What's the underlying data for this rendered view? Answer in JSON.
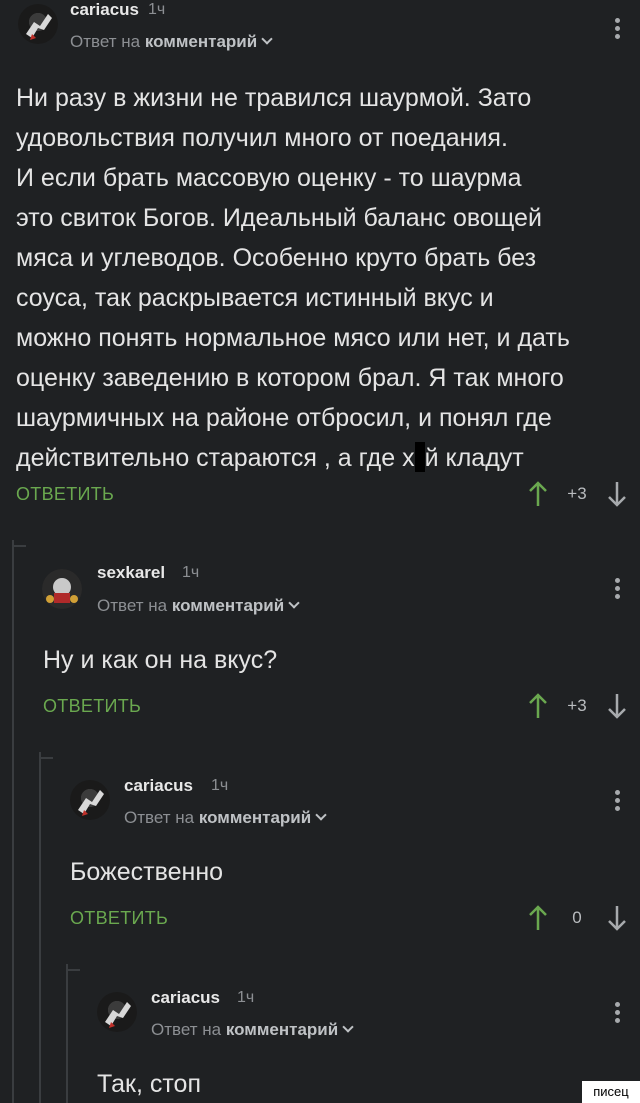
{
  "comments": [
    {
      "username": "cariacus",
      "time": "1ч",
      "reply_prefix": "Ответ на",
      "reply_target": "комментарий",
      "text_before": "Ни разу в жизни не травился шаурмой. Зато\nудовольствия получил много от поедания.\nИ если брать массовую оценку - то шаурма\nэто свиток Богов. Идеальный баланс овощей\nмяса и углеводов. Особенно круто брать без\nсоуса, так раскрывается истинный вкус и\nможно понять нормальное мясо или нет, и дать\nоценку заведению в котором брал. Я так много\nшаурмичных на районе отбросил, и понял где\nдействительно стараются , а где х",
      "text_after": "й кладут",
      "reply_label": "ОТВЕТИТЬ",
      "score": "+3"
    },
    {
      "username": "sexkarel",
      "time": "1ч",
      "reply_prefix": "Ответ на",
      "reply_target": "комментарий",
      "text": "Ну и как он на вкус?",
      "reply_label": "ОТВЕТИТЬ",
      "score": "+3"
    },
    {
      "username": "cariacus",
      "time": "1ч",
      "reply_prefix": "Ответ на",
      "reply_target": "комментарий",
      "text": "Божественно",
      "reply_label": "ОТВЕТИТЬ",
      "score": "0"
    },
    {
      "username": "cariacus",
      "time": "1ч",
      "reply_prefix": "Ответ на",
      "reply_target": "комментарий",
      "text": "Так, стоп"
    }
  ],
  "watermark": "писец",
  "colors": {
    "background": "#1f2123",
    "reply_green": "#6aa84f",
    "thread_line": "#3a3d40",
    "muted": "#8c8f93"
  },
  "icons": [
    "avatar-cariacus",
    "avatar-sexkarel",
    "chevron-down-icon",
    "more-vertical-icon",
    "arrow-up-icon",
    "arrow-down-icon"
  ]
}
